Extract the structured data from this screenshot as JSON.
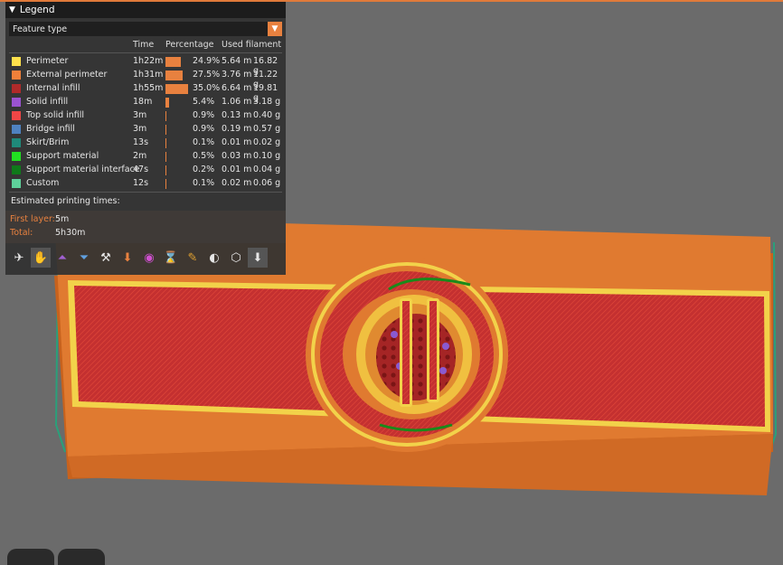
{
  "legend": {
    "title": "Legend",
    "view_type": "Feature type",
    "columns": {
      "time": "Time",
      "percentage": "Percentage",
      "filament": "Used filament"
    },
    "features": [
      {
        "name": "Perimeter",
        "color": "#ffe14c",
        "time": "1h22m",
        "percent": "24.9%",
        "fraction": 0.249,
        "length": "5.64 m",
        "weight": "16.82 g"
      },
      {
        "name": "External perimeter",
        "color": "#f0803a",
        "time": "1h31m",
        "percent": "27.5%",
        "fraction": 0.275,
        "length": "3.76 m",
        "weight": "11.22 g"
      },
      {
        "name": "Internal infill",
        "color": "#b02a2a",
        "time": "1h55m",
        "percent": "35.0%",
        "fraction": 0.35,
        "length": "6.64 m",
        "weight": "19.81 g"
      },
      {
        "name": "Solid infill",
        "color": "#9a53d0",
        "time": "18m",
        "percent": "5.4%",
        "fraction": 0.054,
        "length": "1.06 m",
        "weight": "3.18 g"
      },
      {
        "name": "Top solid infill",
        "color": "#ef4646",
        "time": "3m",
        "percent": "0.9%",
        "fraction": 0.009,
        "length": "0.13 m",
        "weight": "0.40 g"
      },
      {
        "name": "Bridge infill",
        "color": "#4f82c0",
        "time": "3m",
        "percent": "0.9%",
        "fraction": 0.009,
        "length": "0.19 m",
        "weight": "0.57 g"
      },
      {
        "name": "Skirt/Brim",
        "color": "#1f8a7a",
        "time": "13s",
        "percent": "0.1%",
        "fraction": 0.001,
        "length": "0.01 m",
        "weight": "0.02 g"
      },
      {
        "name": "Support material",
        "color": "#22e022",
        "time": "2m",
        "percent": "0.5%",
        "fraction": 0.005,
        "length": "0.03 m",
        "weight": "0.10 g"
      },
      {
        "name": "Support material interface",
        "color": "#0f7a1a",
        "time": "47s",
        "percent": "0.2%",
        "fraction": 0.002,
        "length": "0.01 m",
        "weight": "0.04 g"
      },
      {
        "name": "Custom",
        "color": "#5ed19a",
        "time": "12s",
        "percent": "0.1%",
        "fraction": 0.001,
        "length": "0.02 m",
        "weight": "0.06 g"
      }
    ],
    "estimated_label": "Estimated printing times:",
    "first_layer_label": "First layer:",
    "first_layer_value": "5m",
    "total_label": "Total:",
    "total_value": "5h30m",
    "accent_color": "#e8813f"
  },
  "toolbar_icons": [
    "travel-icon",
    "wipe-icon",
    "retractions-icon",
    "deretractions-icon",
    "seams-icon",
    "tool-changes-icon",
    "color-changes-icon",
    "pause-prints-icon",
    "custom-gcodes-icon",
    "center-of-gravity-icon",
    "shells-icon",
    "tool-marker-icon"
  ]
}
